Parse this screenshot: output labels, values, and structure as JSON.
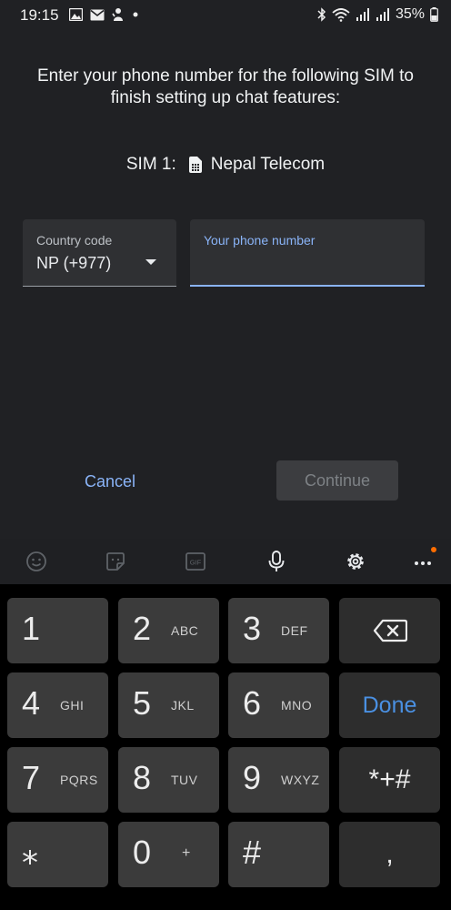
{
  "status_bar": {
    "time": "19:15",
    "battery": "35%",
    "left_icons": [
      "gallery-icon",
      "mail-icon",
      "notification-app-icon",
      "dot-icon"
    ],
    "right_icons": [
      "bluetooth-icon",
      "wifi-icon",
      "signal-icon",
      "signal-icon",
      "battery-icon"
    ]
  },
  "prompt": {
    "text": "Enter your phone number for the following SIM to finish setting up chat features:"
  },
  "sim": {
    "label": "SIM 1:",
    "carrier": "Nepal Telecom",
    "icon": "sim-card-icon"
  },
  "country_field": {
    "label": "Country code",
    "value": "NP (+977)"
  },
  "phone_field": {
    "label": "Your phone number",
    "value": ""
  },
  "actions": {
    "cancel": "Cancel",
    "continue": "Continue"
  },
  "keyboard_toolbar": {
    "icons": [
      "emoji-icon",
      "sticker-icon",
      "gif-icon",
      "microphone-icon",
      "settings-icon",
      "more-icon"
    ],
    "gif_label": "GIF",
    "badge_color": "#ff6d00"
  },
  "keypad": {
    "keys": [
      {
        "digit": "1",
        "letters": ""
      },
      {
        "digit": "2",
        "letters": "ABC"
      },
      {
        "digit": "3",
        "letters": "DEF"
      },
      {
        "digit": "4",
        "letters": "GHI"
      },
      {
        "digit": "5",
        "letters": "JKL"
      },
      {
        "digit": "6",
        "letters": "MNO"
      },
      {
        "digit": "7",
        "letters": "PQRS"
      },
      {
        "digit": "8",
        "letters": "TUV"
      },
      {
        "digit": "9",
        "letters": "WXYZ"
      },
      {
        "digit": "⁎",
        "letters": ""
      },
      {
        "digit": "0",
        "letters": "+"
      },
      {
        "digit": "#",
        "letters": ""
      }
    ],
    "done_label": "Done",
    "symbols_label": "*+#",
    "comma_label": ",",
    "accent_color": "#4a90e2"
  },
  "colors": {
    "background": "#202124",
    "accent_blue": "#8ab4f8",
    "field_bg": "#2f3033"
  }
}
